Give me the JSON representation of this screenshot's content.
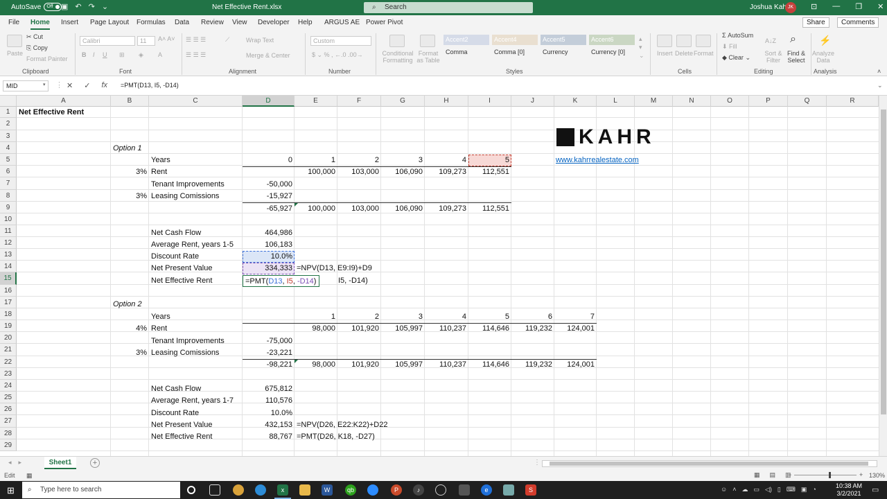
{
  "titlebar": {
    "autosave_label": "AutoSave",
    "autosave_state": "Off",
    "doc_title": "Net Effective Rent.xlsx",
    "search_placeholder": "Search",
    "user_name": "Joshua Kahr",
    "user_initials": "JK"
  },
  "tabs": [
    "File",
    "Home",
    "Insert",
    "Page Layout",
    "Formulas",
    "Data",
    "Review",
    "View",
    "Developer",
    "Help",
    "ARGUS AE",
    "Power Pivot"
  ],
  "share_label": "Share",
  "comments_label": "Comments",
  "ribbon": {
    "paste": "Paste",
    "cut": "Cut",
    "copy": "Copy",
    "format_painter": "Format Painter",
    "clipboard": "Clipboard",
    "font_name": "Calibri",
    "font_size": "11",
    "font": "Font",
    "wrap_text": "Wrap Text",
    "merge_center": "Merge & Center",
    "alignment": "Alignment",
    "number_format": "Custom",
    "number": "Number",
    "conditional_formatting": "Conditional Formatting",
    "format_as_table": "Format as Table",
    "style_accent2": "Accent2",
    "style_accent4": "Accent4",
    "style_accent5": "Accent5",
    "style_accent6": "Accent6",
    "style_comma": "Comma",
    "style_comma0": "Comma [0]",
    "style_currency": "Currency",
    "style_currency0": "Currency [0]",
    "styles": "Styles",
    "insert": "Insert",
    "delete": "Delete",
    "format": "Format",
    "cells": "Cells",
    "autosum": "AutoSum",
    "fill": "Fill",
    "clear": "Clear",
    "sort_filter": "Sort & Filter",
    "find_select": "Find & Select",
    "editing": "Editing",
    "analyze_data": "Analyze Data",
    "analysis": "Analysis"
  },
  "formula_bar": {
    "name_box": "MID",
    "formula": "=PMT(D13, I5, -D14)"
  },
  "columns": [
    "A",
    "B",
    "C",
    "D",
    "E",
    "F",
    "G",
    "H",
    "I",
    "J",
    "K",
    "L",
    "M",
    "N",
    "O",
    "P",
    "Q",
    "R"
  ],
  "rows": [
    "1",
    "2",
    "3",
    "4",
    "5",
    "6",
    "7",
    "8",
    "9",
    "10",
    "11",
    "12",
    "13",
    "14",
    "15",
    "16",
    "17",
    "18",
    "19",
    "20",
    "21",
    "22",
    "23",
    "24",
    "25",
    "26",
    "27",
    "28",
    "29"
  ],
  "sheet": {
    "title": "Net Effective Rent",
    "option1": "Option 1",
    "option2": "Option 2",
    "website": "www.kahrrealestate.com",
    "logo_text": "KAHR",
    "o1": {
      "years_label": "Years",
      "years": [
        "0",
        "1",
        "2",
        "3",
        "4",
        "5"
      ],
      "rent_growth": "3%",
      "rent_label": "Rent",
      "rent": [
        "100,000",
        "103,000",
        "106,090",
        "109,273",
        "112,551"
      ],
      "ti_label": "Tenant Improvements",
      "ti": "-50,000",
      "lc_pct": "3%",
      "lc_label": "Leasing Comissions",
      "lc": "-15,927",
      "totals": [
        "-65,927",
        "100,000",
        "103,000",
        "106,090",
        "109,273",
        "112,551"
      ],
      "ncf_label": "Net Cash Flow",
      "ncf": "464,986",
      "avg_label": "Average Rent, years 1-5",
      "avg": "106,183",
      "dr_label": "Discount Rate",
      "dr": "10.0%",
      "npv_label": "Net Present Value",
      "npv": "334,333",
      "npv_formula": "=NPV(D13, E9:I9)+D9",
      "ner_label": "Net Effective Rent",
      "ner_edit_prefix": "=PMT(",
      "ner_edit_ref1": "D13",
      "ner_edit_sep1": ", ",
      "ner_edit_ref2": "I5",
      "ner_edit_sep2": ", ",
      "ner_edit_ref3": "-D14",
      "ner_edit_suffix": ")",
      "ner_overflow": "I5, -D14)"
    },
    "o2": {
      "years_label": "Years",
      "years": [
        "1",
        "2",
        "3",
        "4",
        "5",
        "6",
        "7"
      ],
      "rent_growth": "4%",
      "rent_label": "Rent",
      "rent": [
        "98,000",
        "101,920",
        "105,997",
        "110,237",
        "114,646",
        "119,232",
        "124,001"
      ],
      "ti_label": "Tenant Improvements",
      "ti": "-75,000",
      "lc_pct": "3%",
      "lc_label": "Leasing Comissions",
      "lc": "-23,221",
      "totals": [
        "-98,221",
        "98,000",
        "101,920",
        "105,997",
        "110,237",
        "114,646",
        "119,232",
        "124,001"
      ],
      "ncf_label": "Net Cash Flow",
      "ncf": "675,812",
      "avg_label": "Average Rent, years 1-7",
      "avg": "110,576",
      "dr_label": "Discount Rate",
      "dr": "10.0%",
      "npv_label": "Net Present Value",
      "npv": "432,153",
      "npv_formula": "=NPV(D26, E22:K22)+D22",
      "ner_label": "Net Effective Rent",
      "ner": "88,767",
      "ner_formula": "=PMT(D26, K18, -D27)"
    }
  },
  "sheet_tab": "Sheet1",
  "status": {
    "mode": "Edit",
    "zoom": "130%"
  },
  "taskbar": {
    "search_placeholder": "Type here to search",
    "time": "10:38 AM",
    "date": "3/2/2021"
  },
  "colors": {
    "excel_green": "#217346",
    "link_blue": "#0563c1",
    "ref_blue": "#3a6fd8",
    "ref_red": "#c0392b",
    "ref_purple": "#7d4fb5"
  }
}
